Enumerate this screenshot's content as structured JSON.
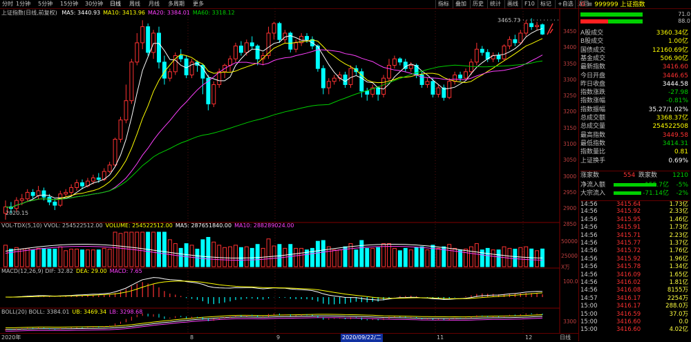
{
  "toolbar": {
    "left_items": [
      "分时",
      "1分钟",
      "5分钟",
      "15分钟",
      "30分钟",
      "日线",
      "周线",
      "月线",
      "多周期",
      "更多"
    ],
    "active": "日线",
    "right_items": [
      "指标",
      "叠加",
      "历史",
      "统计",
      "画线",
      "F10",
      "标记",
      "+自选",
      "返回"
    ]
  },
  "main_legend": {
    "title": "上证指数(日线,前复权)",
    "items": [
      {
        "label": "MA5: 3440.93",
        "color": "#ffffff"
      },
      {
        "label": "MA10: 3413.96",
        "color": "#ffff00"
      },
      {
        "label": "MA20: 3384.01",
        "color": "#ff40ff"
      },
      {
        "label": "MA60: 3318.12",
        "color": "#00d000"
      }
    ]
  },
  "high_label": "3465.73",
  "low_label": "2020.15",
  "price_axis": [
    "3450",
    "3400",
    "3350",
    "3300",
    "3250",
    "3200",
    "3150",
    "3100",
    "3050",
    "3000",
    "2950",
    "2900",
    "2850"
  ],
  "vol_legend": {
    "items": [
      {
        "label": "VOL-TDX(5,10) VVOL: 254522512.00",
        "color": "#c0c0c0"
      },
      {
        "label": "VOLUME: 254522512.00",
        "color": "#ffff00"
      },
      {
        "label": "MA5: 287651840.00",
        "color": "#ffffff"
      },
      {
        "label": "MA10: 288289024.00",
        "color": "#ff40ff"
      }
    ]
  },
  "vol_axis": [
    "50000",
    "25000",
    "X万"
  ],
  "macd_legend": {
    "items": [
      {
        "label": "MACD(12,26,9) DIF: 32.82",
        "color": "#c0c0c0"
      },
      {
        "label": "DEA: 29.00",
        "color": "#ffff00"
      },
      {
        "label": "MACD: 7.65",
        "color": "#ff40ff"
      }
    ]
  },
  "macd_axis": [
    "100.0"
  ],
  "boll_legend": {
    "items": [
      {
        "label": "BOLL(20) BOLL: 3384.01",
        "color": "#c0c0c0"
      },
      {
        "label": "UB: 3469.34",
        "color": "#ffff00"
      },
      {
        "label": "LB: 3298.68",
        "color": "#ff40ff"
      }
    ]
  },
  "boll_axis": [
    "3300"
  ],
  "bottom": {
    "year": "2020年",
    "months": [
      "8",
      "9",
      "11",
      "12"
    ],
    "cursor_date": "2020/09/22/二",
    "right": "日线"
  },
  "right_panel": {
    "code": "999999",
    "name": "上证指数",
    "bar_top_value": "71.0",
    "bar_bottom_value": "88.0",
    "stats": [
      {
        "k": "A股成交",
        "v": "3360.34亿",
        "c": "#ffff00"
      },
      {
        "k": "B股成交",
        "v": "1.00亿",
        "c": "#ffff00"
      },
      {
        "k": "国债成交",
        "v": "12160.69亿",
        "c": "#ffff00"
      },
      {
        "k": "基金成交",
        "v": "506.90亿",
        "c": "#ffff00"
      },
      {
        "k": "最新指数",
        "v": "3416.60",
        "c": "#ff3232"
      },
      {
        "k": "今日开盘",
        "v": "3446.65",
        "c": "#ff3232"
      },
      {
        "k": "昨日收盘",
        "v": "3444.58",
        "c": "#ffffff"
      },
      {
        "k": "指数涨跌",
        "v": "-27.98",
        "c": "#00d000"
      },
      {
        "k": "指数涨幅",
        "v": "-0.81%",
        "c": "#00d000"
      },
      {
        "k": "指数振幅",
        "v": "35.27/1.02%",
        "c": "#ffffff"
      },
      {
        "k": "总成交额",
        "v": "3368.37亿",
        "c": "#ffff00"
      },
      {
        "k": "总成交量",
        "v": "254522508",
        "c": "#ffff00"
      },
      {
        "k": "最高指数",
        "v": "3449.58",
        "c": "#ff3232"
      },
      {
        "k": "最低指数",
        "v": "3414.31",
        "c": "#00d000"
      },
      {
        "k": "指数量比",
        "v": "0.81",
        "c": "#ffff00"
      },
      {
        "k": "上证换手",
        "v": "0.69%",
        "c": "#ffffff"
      }
    ],
    "breadth": {
      "up_label": "涨家数",
      "up": "554",
      "down_label": "跌家数",
      "down": "1210"
    },
    "flows": [
      {
        "k": "净流入额",
        "v": "-155.7亿",
        "pct": "-5%"
      },
      {
        "k": "大宗流入",
        "v": "-71.14亿",
        "pct": "-2%"
      }
    ],
    "ticks": [
      {
        "t": "14:56",
        "p": "3415.64",
        "q": "1.73亿"
      },
      {
        "t": "14:56",
        "p": "3415.92",
        "q": "2.33亿"
      },
      {
        "t": "14:56",
        "p": "3415.95",
        "q": "1.46亿"
      },
      {
        "t": "14:56",
        "p": "3415.91",
        "q": "1.73亿"
      },
      {
        "t": "14:56",
        "p": "3415.71",
        "q": "2.23亿"
      },
      {
        "t": "14:56",
        "p": "3415.77",
        "q": "1.37亿"
      },
      {
        "t": "14:56",
        "p": "3415.72",
        "q": "1.76亿"
      },
      {
        "t": "14:56",
        "p": "3415.92",
        "q": "1.96亿"
      },
      {
        "t": "14:56",
        "p": "3415.78",
        "q": "1.34亿"
      },
      {
        "t": "14:56",
        "p": "3416.09",
        "q": "1.65亿"
      },
      {
        "t": "14:56",
        "p": "3416.02",
        "q": "1.81亿"
      },
      {
        "t": "14:56",
        "p": "3416.08",
        "q": "8155万"
      },
      {
        "t": "14:57",
        "p": "3416.17",
        "q": "2254万"
      },
      {
        "t": "15:00",
        "p": "3416.17",
        "q": "288.0万"
      },
      {
        "t": "15:00",
        "p": "3416.59",
        "q": "37.0万"
      },
      {
        "t": "15:00",
        "p": "3416.60",
        "q": "0.0"
      },
      {
        "t": "15:00",
        "p": "3416.60",
        "q": "4.02亿"
      }
    ]
  },
  "chart_data": {
    "type": "candlestick",
    "ylim": [
      2840,
      3480
    ],
    "price_series_note": "",
    "candles": [
      [
        2860,
        2880,
        2840,
        2900
      ],
      [
        2880,
        2875,
        2860,
        2895
      ],
      [
        2875,
        2900,
        2865,
        2910
      ],
      [
        2900,
        2905,
        2885,
        2920
      ],
      [
        2905,
        2925,
        2895,
        2935
      ],
      [
        2925,
        2915,
        2905,
        2935
      ],
      [
        2915,
        2930,
        2905,
        2945
      ],
      [
        2930,
        2910,
        2900,
        2940
      ],
      [
        2910,
        2895,
        2885,
        2920
      ],
      [
        2895,
        2885,
        2870,
        2905
      ],
      [
        2885,
        2920,
        2880,
        2930
      ],
      [
        2920,
        2925,
        2910,
        2935
      ],
      [
        2925,
        2940,
        2915,
        2950
      ],
      [
        2940,
        2955,
        2930,
        2965
      ],
      [
        2955,
        2945,
        2935,
        2965
      ],
      [
        2945,
        2960,
        2940,
        2970
      ],
      [
        2960,
        2970,
        2950,
        2980
      ],
      [
        2970,
        2965,
        2955,
        2985
      ],
      [
        2965,
        2990,
        2960,
        3000
      ],
      [
        2990,
        3010,
        2985,
        3020
      ],
      [
        3010,
        3090,
        3005,
        3095
      ],
      [
        3090,
        3150,
        3080,
        3160
      ],
      [
        3150,
        3210,
        3140,
        3260
      ],
      [
        3210,
        3330,
        3200,
        3340
      ],
      [
        3330,
        3390,
        3320,
        3420
      ],
      [
        3390,
        3440,
        3370,
        3460
      ],
      [
        3440,
        3360,
        3350,
        3450
      ],
      [
        3360,
        3420,
        3340,
        3430
      ],
      [
        3420,
        3330,
        3310,
        3440
      ],
      [
        3330,
        3280,
        3260,
        3350
      ],
      [
        3280,
        3300,
        3270,
        3310
      ],
      [
        3300,
        3350,
        3290,
        3360
      ],
      [
        3350,
        3340,
        3330,
        3370
      ],
      [
        3340,
        3290,
        3280,
        3350
      ],
      [
        3290,
        3330,
        3280,
        3340
      ],
      [
        3330,
        3320,
        3300,
        3335
      ],
      [
        3320,
        3280,
        3230,
        3325
      ],
      [
        3280,
        3200,
        3180,
        3290
      ],
      [
        3200,
        3260,
        3190,
        3270
      ],
      [
        3260,
        3300,
        3250,
        3310
      ],
      [
        3300,
        3320,
        3280,
        3325
      ],
      [
        3320,
        3340,
        3300,
        3350
      ],
      [
        3340,
        3380,
        3330,
        3390
      ],
      [
        3380,
        3360,
        3350,
        3395
      ],
      [
        3360,
        3390,
        3350,
        3400
      ],
      [
        3390,
        3380,
        3370,
        3410
      ],
      [
        3380,
        3340,
        3320,
        3385
      ],
      [
        3340,
        3350,
        3320,
        3360
      ],
      [
        3350,
        3420,
        3340,
        3440
      ],
      [
        3420,
        3450,
        3400,
        3455
      ],
      [
        3450,
        3400,
        3390,
        3455
      ],
      [
        3400,
        3420,
        3390,
        3430
      ],
      [
        3420,
        3370,
        3360,
        3425
      ],
      [
        3370,
        3390,
        3360,
        3400
      ],
      [
        3390,
        3410,
        3380,
        3420
      ],
      [
        3410,
        3400,
        3390,
        3420
      ],
      [
        3400,
        3380,
        3370,
        3410
      ],
      [
        3380,
        3310,
        3300,
        3385
      ],
      [
        3310,
        3250,
        3230,
        3320
      ],
      [
        3250,
        3270,
        3230,
        3280
      ],
      [
        3270,
        3280,
        3260,
        3290
      ],
      [
        3280,
        3290,
        3270,
        3300
      ],
      [
        3290,
        3260,
        3250,
        3300
      ],
      [
        3260,
        3310,
        3250,
        3320
      ],
      [
        3310,
        3300,
        3290,
        3320
      ],
      [
        3300,
        3240,
        3220,
        3310
      ],
      [
        3240,
        3230,
        3210,
        3250
      ],
      [
        3230,
        3250,
        3220,
        3260
      ],
      [
        3250,
        3230,
        3210,
        3255
      ],
      [
        3230,
        3280,
        3220,
        3290
      ],
      [
        3280,
        3320,
        3270,
        3340
      ],
      [
        3320,
        3340,
        3310,
        3350
      ],
      [
        3340,
        3330,
        3320,
        3345
      ],
      [
        3330,
        3310,
        3300,
        3340
      ],
      [
        3310,
        3320,
        3300,
        3330
      ],
      [
        3320,
        3290,
        3280,
        3325
      ],
      [
        3290,
        3260,
        3250,
        3300
      ],
      [
        3260,
        3270,
        3250,
        3280
      ],
      [
        3270,
        3230,
        3220,
        3280
      ],
      [
        3230,
        3250,
        3220,
        3260
      ],
      [
        3250,
        3220,
        3210,
        3260
      ],
      [
        3220,
        3270,
        3215,
        3280
      ],
      [
        3270,
        3290,
        3260,
        3300
      ],
      [
        3290,
        3280,
        3270,
        3300
      ],
      [
        3280,
        3300,
        3275,
        3310
      ],
      [
        3300,
        3330,
        3290,
        3340
      ],
      [
        3330,
        3370,
        3320,
        3390
      ],
      [
        3370,
        3360,
        3350,
        3380
      ],
      [
        3360,
        3340,
        3330,
        3370
      ],
      [
        3340,
        3350,
        3330,
        3360
      ],
      [
        3350,
        3340,
        3330,
        3360
      ],
      [
        3340,
        3380,
        3335,
        3385
      ],
      [
        3380,
        3400,
        3370,
        3410
      ],
      [
        3400,
        3390,
        3380,
        3415
      ],
      [
        3390,
        3420,
        3385,
        3430
      ],
      [
        3420,
        3450,
        3410,
        3460
      ],
      [
        3450,
        3440,
        3430,
        3466
      ],
      [
        3440,
        3444,
        3430,
        3455
      ],
      [
        3446,
        3417,
        3414,
        3450
      ]
    ]
  }
}
